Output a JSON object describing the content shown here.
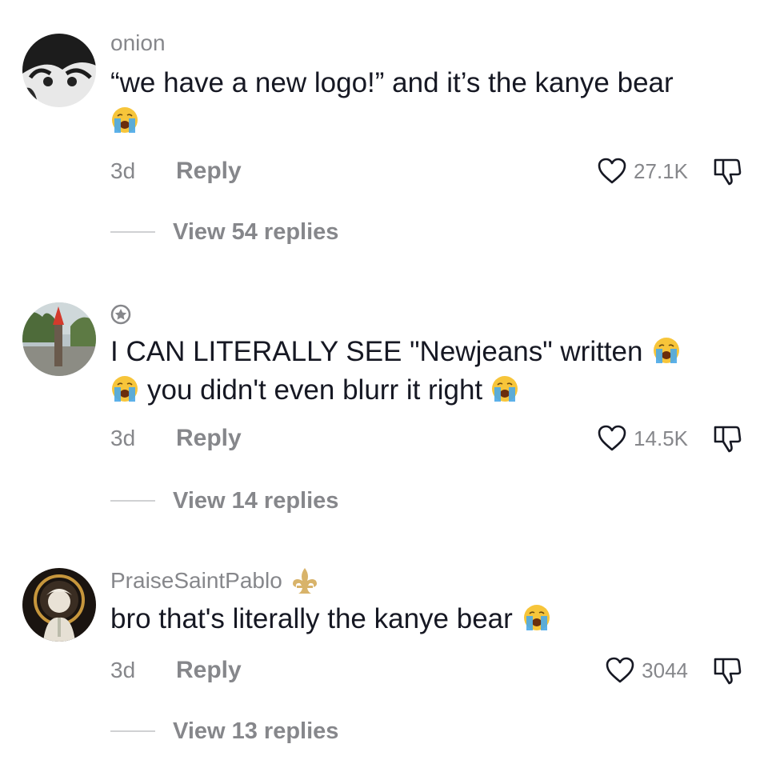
{
  "comments": [
    {
      "username": "onion",
      "lines": [
        "“we have a new logo!” and it’s the kanye bear",
        ""
      ],
      "emoji": "loudly-crying-face",
      "time": "3d",
      "reply_label": "Reply",
      "likes": "27.1K",
      "view_replies": "View 54 replies"
    },
    {
      "username": "",
      "username_icon": "star-badge-icon",
      "lines": [
        "I CAN LITERALLY SEE \"Newjeans\" written",
        "you didn't even blurr it right"
      ],
      "emoji": "loudly-crying-face",
      "time": "3d",
      "reply_label": "Reply",
      "likes": "14.5K",
      "view_replies": "View 14 replies"
    },
    {
      "username": "PraiseSaintPablo",
      "username_icon": "fleur-de-lis-icon",
      "lines": [
        "bro that's literally the kanye bear"
      ],
      "emoji": "loudly-crying-face",
      "time": "3d",
      "reply_label": "Reply",
      "likes": "3044",
      "view_replies": "View 13 replies"
    }
  ],
  "colors": {
    "text_primary": "#161823",
    "text_secondary": "#86878b",
    "emoji_face": "#f7c53a",
    "emoji_tears": "#4aa8e8"
  }
}
